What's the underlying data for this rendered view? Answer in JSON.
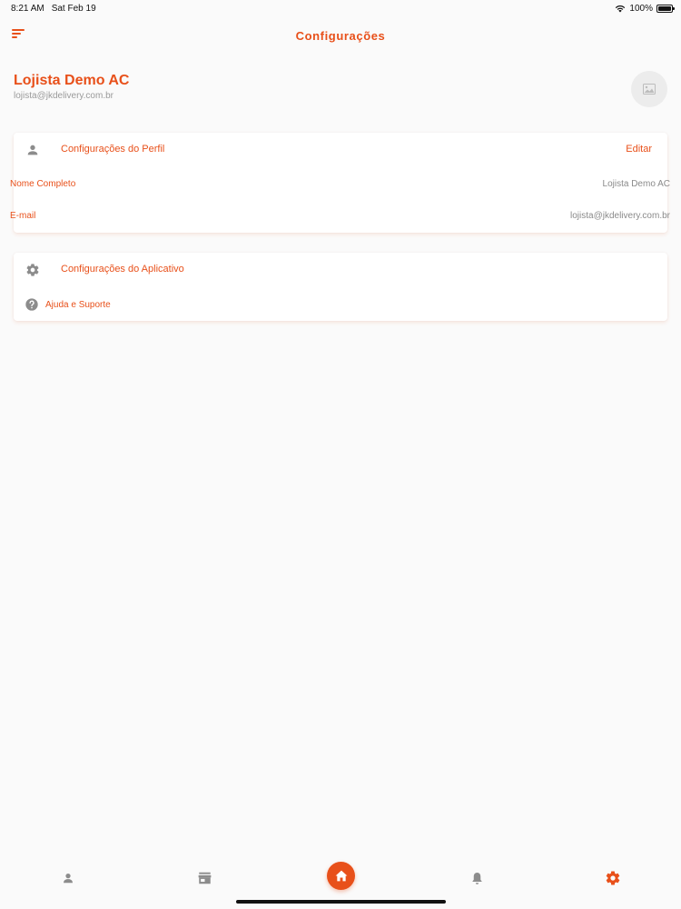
{
  "status_bar": {
    "time": "8:21 AM",
    "date": "Sat Feb 19",
    "battery": "100%"
  },
  "header": {
    "title": "Configurações",
    "menu_icon": "sort-icon"
  },
  "profile": {
    "name": "Lojista Demo AC",
    "email": "lojista@jkdelivery.com.br",
    "avatar_icon": "image-placeholder-icon"
  },
  "profile_card": {
    "title": "Configurações do Perfil",
    "edit_label": "Editar",
    "icon": "person-icon",
    "fields": [
      {
        "label": "Nome Completo",
        "value": "Lojista Demo AC"
      },
      {
        "label": "E-mail",
        "value": "lojista@jkdelivery.com.br"
      }
    ]
  },
  "app_card": {
    "title": "Configurações do Aplicativo",
    "icon": "gear-icon",
    "help_label": "Ajuda e Suporte",
    "help_icon": "help-icon"
  },
  "bottom_nav": {
    "items": [
      {
        "name": "person",
        "icon": "person-icon",
        "active": false
      },
      {
        "name": "store",
        "icon": "store-icon",
        "active": false
      },
      {
        "name": "home",
        "icon": "home-icon",
        "active": false
      },
      {
        "name": "notifications",
        "icon": "bell-icon",
        "active": false
      },
      {
        "name": "settings",
        "icon": "gear-icon",
        "active": true
      }
    ]
  },
  "colors": {
    "accent": "#e8501a",
    "icon_gray": "#8c8c8c",
    "text_gray": "#8a8a8a",
    "background": "#fafafa"
  }
}
